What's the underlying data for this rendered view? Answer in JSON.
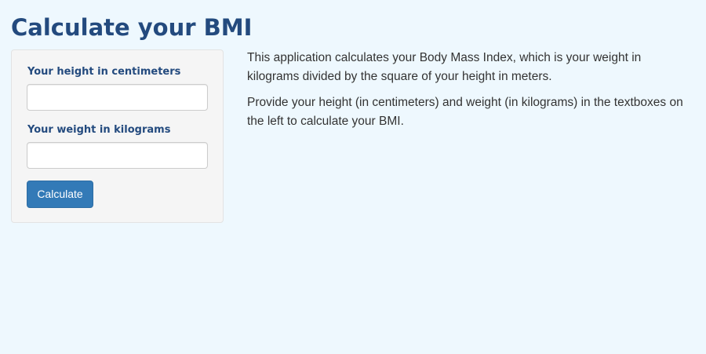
{
  "page": {
    "title": "Calculate your BMI"
  },
  "sidebar": {
    "height_label": "Your height in centimeters",
    "height_value": "",
    "weight_label": "Your weight in kilograms",
    "weight_value": "",
    "calculate_label": "Calculate"
  },
  "main": {
    "paragraphs": [
      "This application calculates your Body Mass Index, which is your weight in kilograms divided by the square of your height in meters.",
      "Provide your height (in centimeters) and weight (in kilograms) in the textboxes on the left to calculate your BMI."
    ]
  },
  "colors": {
    "background": "#eef8fe",
    "heading": "#234a7e",
    "panel": "#f5f5f5",
    "button": "#337ab7",
    "text": "#333333"
  }
}
